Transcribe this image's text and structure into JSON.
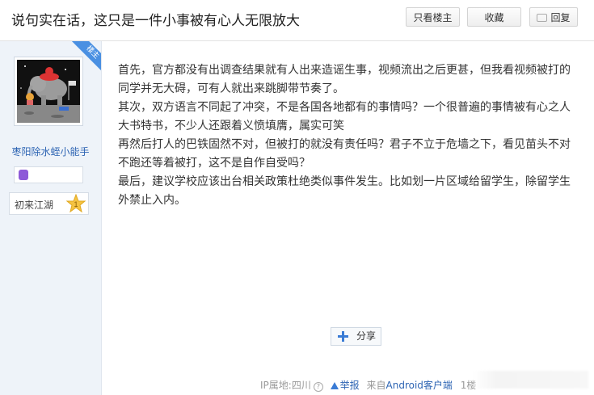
{
  "header": {
    "title": "说句实在话，这只是一件小事被有心人无限放大",
    "btn_only_op": "只看楼主",
    "btn_favorite": "收藏",
    "btn_reply": "回复"
  },
  "author": {
    "name": "枣阳除水蛭小能手",
    "level_name": "初来江湖",
    "level_num": "1",
    "corner_badge": "楼主"
  },
  "post": {
    "paragraphs": [
      "首先，官方都没有出调查结果就有人出来造谣生事，视频流出之后更甚，但我看视频被打的同学并无大碍，可有人就出来跳脚带节奏了。",
      "其次，双方语言不同起了冲突，不是各国各地都有的事情吗？一个很普遍的事情被有心之人大书特书，不少人还跟着义愤填膺，属实可笑",
      "再然后打人的巴铁固然不对，但被打的就没有责任吗？君子不立于危墙之下，看见苗头不对不跑还等着被打，这不是自作自受吗？",
      "最后，建议学校应该出台相关政策杜绝类似事件发生。比如划一片区域给留学生，除留学生外禁止入内。"
    ],
    "share_label": "分享"
  },
  "footer": {
    "ip": "IP属地:四川",
    "report": "举报",
    "source_prefix": "来自",
    "source_link": "Android客户端",
    "floor": "1楼"
  },
  "colors": {
    "link": "#2d64b3",
    "sidebar_bg": "#eef3f9",
    "accent": "#4a90e2"
  }
}
